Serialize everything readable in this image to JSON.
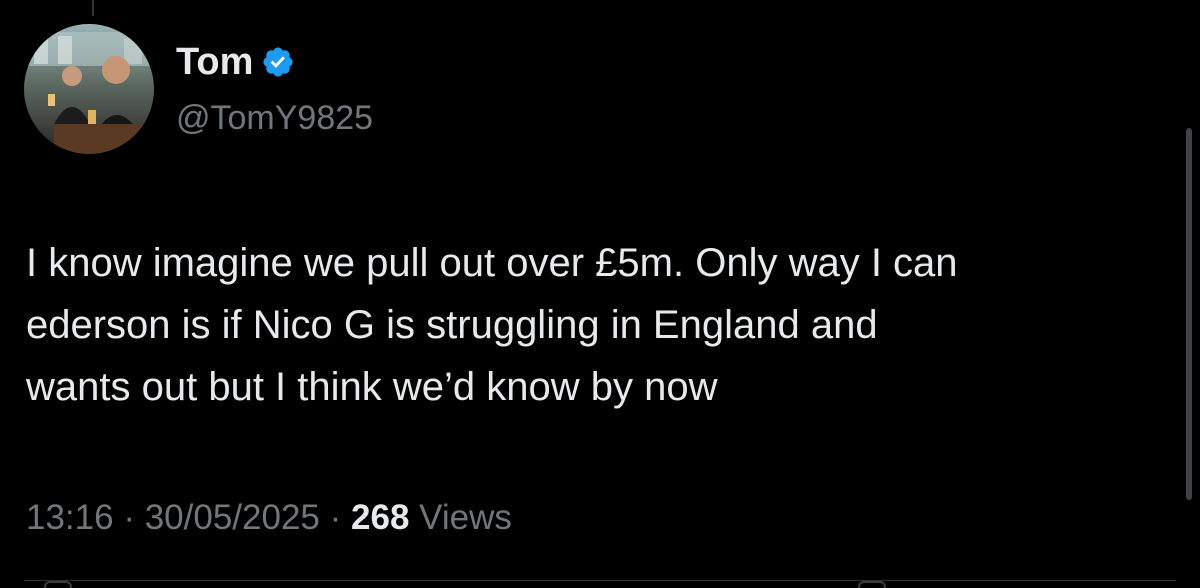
{
  "author": {
    "display_name": "Tom",
    "handle": "@TomY9825",
    "verified": true,
    "avatar_icon": "profile-photo"
  },
  "tweet": {
    "text": "I know imagine we pull out over £5m. Only way I can\nederson is if Nico G is struggling in England and\nwants out but I think we’d know by now",
    "time": "13:16",
    "separator": "·",
    "date": "30/05/2025",
    "views_count": "268",
    "views_label": "Views"
  },
  "colors": {
    "background": "#000000",
    "primary_text": "#e7e9ea",
    "secondary_text": "#71767b",
    "verified_badge": "#1d9bf0"
  }
}
